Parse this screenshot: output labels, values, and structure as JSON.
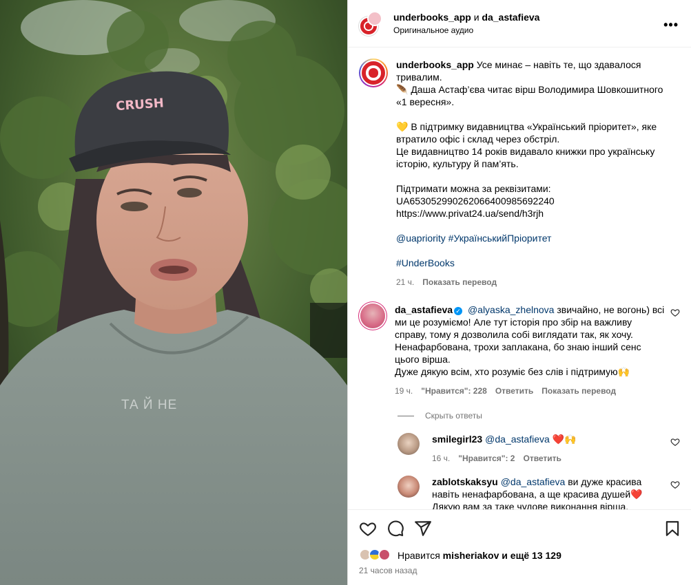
{
  "video": {
    "caption_overlay": "ТА Й НЕ"
  },
  "header": {
    "user1": "underbooks_app",
    "conj": "и",
    "user2": "da_astafieva",
    "audio": "Оригинальное аудио",
    "more_icon": "more-horizontal-icon",
    "more_glyph": "•••"
  },
  "post": {
    "username": "underbooks_app",
    "lines": [
      "Усе минає – навіть те, що здавалося тривалим.",
      "🪶 Даша Астаф’єва читає вірш Володимира Шовкошитного «1 вересня».",
      "",
      "💛 В підтримку видавництва «Український пріоритет», яке втратило офіс і склад через обстріл.",
      "Це видавництво 14 років видавало книжки про українську історію, культуру й пам’ять.",
      "",
      "Підтримати можна за реквізитами:",
      "UA653052990262066400985692240",
      "https://www.privat24.ua/send/h3rjh",
      ""
    ],
    "tags_line": "@uapriority #УкраїнськийПріоритет",
    "tag2": "#UnderBooks",
    "time": "21 ч.",
    "translate": "Показать перевод"
  },
  "comment": {
    "username": "da_astafieva",
    "verified_glyph": "✓",
    "mention": "@alyaska_zhelnova",
    "text": "звичайно, не вогонь) всі ми це розуміємо! Але тут історія про збір на важливу справу, тому я дозволила собі виглядати так, як хочу. Ненафарбована, трохи заплакана, бо знаю інший сенс цього вірша.",
    "text2": "Дуже дякую всім, хто розуміє без слів і підтримую🙌",
    "time": "19 ч.",
    "likes": "\"Нравится\": 228",
    "reply": "Ответить",
    "translate": "Показать перевод"
  },
  "hide_replies": "Скрыть ответы",
  "replies": [
    {
      "username": "smilegirl23",
      "mention": "@da_astafieva",
      "text": "❤️🙌",
      "time": "16 ч.",
      "likes": "\"Нравится\": 2",
      "reply": "Ответить"
    },
    {
      "username": "zablotskaksyu",
      "mention": "@da_astafieva",
      "text": "ви дуже красива навіть ненафарбована, а ще красива душей❤️ Дякую вам за таке чудове виконання вірша."
    }
  ],
  "actions": {
    "like_icon": "heart-icon",
    "comment_icon": "comment-icon",
    "share_icon": "share-icon",
    "save_icon": "bookmark-icon"
  },
  "likes": {
    "prefix": "Нравится",
    "user": "misheriakov",
    "middle": "и",
    "rest": "ещё 13 129"
  },
  "posted": "21 часов назад",
  "colors": {
    "link": "#00376b",
    "brand_red": "#d8232a",
    "verified": "#0095f6",
    "muted": "#737373"
  }
}
